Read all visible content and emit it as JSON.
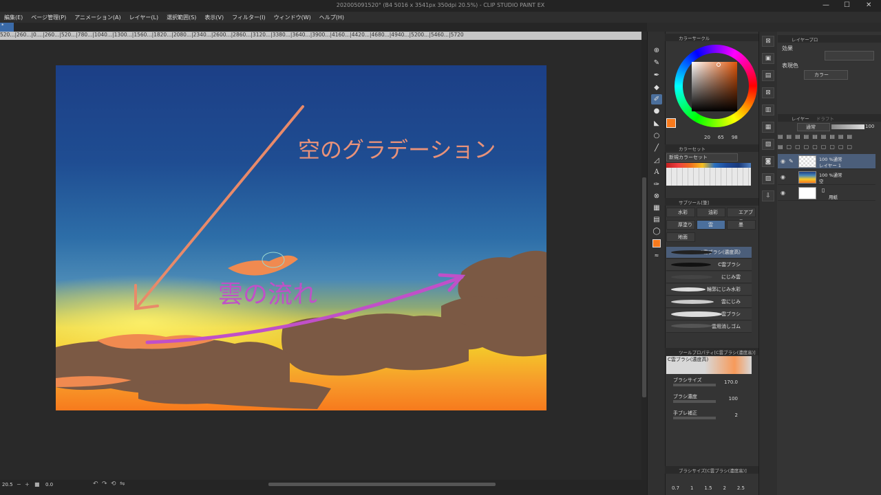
{
  "window": {
    "title": "202005091520° (B4 5016 x 3541px 350dpi 20.5%) - CLIP STUDIO PAINT EX",
    "min": "—",
    "max": "☐",
    "close": "✕"
  },
  "menu": [
    "編集(E)",
    "ページ管理(P)",
    "アニメーション(A)",
    "レイヤー(L)",
    "選択範囲(S)",
    "表示(V)",
    "フィルター(I)",
    "ウィンドウ(W)",
    "ヘルプ(H)"
  ],
  "tab": {
    "label": "*"
  },
  "ruler": {
    "ticks": "520...|260...|0....|260...|520...|780...|1040...|1300...|1560...|1820...|2080...|2340...|2600...|2860...|3120...|3380...|3640...|3900...|4160...|4420...|4680...|4940...|5200...|5460...|5720"
  },
  "canvas": {
    "annotation1": "空のグラデーション",
    "annotation2": "雲の流れ",
    "colors": {
      "sky_top": "#1c3f86",
      "sky_mid": "#2d6ea8",
      "yellow": "#f4c82a",
      "orange": "#f77a1d",
      "cloud": "#7a5a45",
      "arrow1": "#e88a6a",
      "arrow2": "#c050c8"
    }
  },
  "status": {
    "zoom": "20.5",
    "angle": "0.0"
  },
  "colorpanel": {
    "title": "カラーサークル",
    "h": "20",
    "s": "65",
    "v": "98",
    "main_color": "#f77a1d"
  },
  "colorset": {
    "title": "カラーセット",
    "set_name": "新規カラーセット"
  },
  "subtool": {
    "title": "サブツール[筆]",
    "tabs": [
      "水彩",
      "油彩",
      "エアブラ",
      "厚塗り",
      "雲",
      "墨",
      "地面"
    ],
    "active_tab": "雲",
    "brushes": [
      "C雲ブラシ(濃度高)",
      "C雲ブラシ",
      "にじみ雲",
      "輪郭にじみ水彩",
      "雲にじみ",
      "雲ブラシ",
      "雲用消しゴム"
    ]
  },
  "toolprop": {
    "title": "ツールプロパティ[C雲ブラシ(濃度高)]",
    "brush_name": "C雲ブラシ(濃度高)",
    "brush_size_label": "ブラシサイズ",
    "brush_size": "170.0",
    "density_label": "ブラシ濃度",
    "density": "100",
    "stabilization_label": "手ブレ補正",
    "stabilization": "2"
  },
  "brushsize": {
    "title": "ブラシサイズ[C雲ブラシ(濃度高)]",
    "sizes": [
      "0.7",
      "1",
      "1.5",
      "2",
      "2.5"
    ]
  },
  "effects": {
    "panel_tab": "レイヤープロ",
    "title": "効果",
    "color_label": "表現色",
    "color_value": "カラー"
  },
  "layers": {
    "tab1": "レイヤー",
    "tab2": "ドラフト",
    "blend": "通常",
    "opacity": "100",
    "items": [
      {
        "mode": "100 %通常",
        "name": "レイヤー 1"
      },
      {
        "mode": "100 %通常",
        "name": "空"
      },
      {
        "mode": "",
        "name": "用紙"
      }
    ]
  }
}
